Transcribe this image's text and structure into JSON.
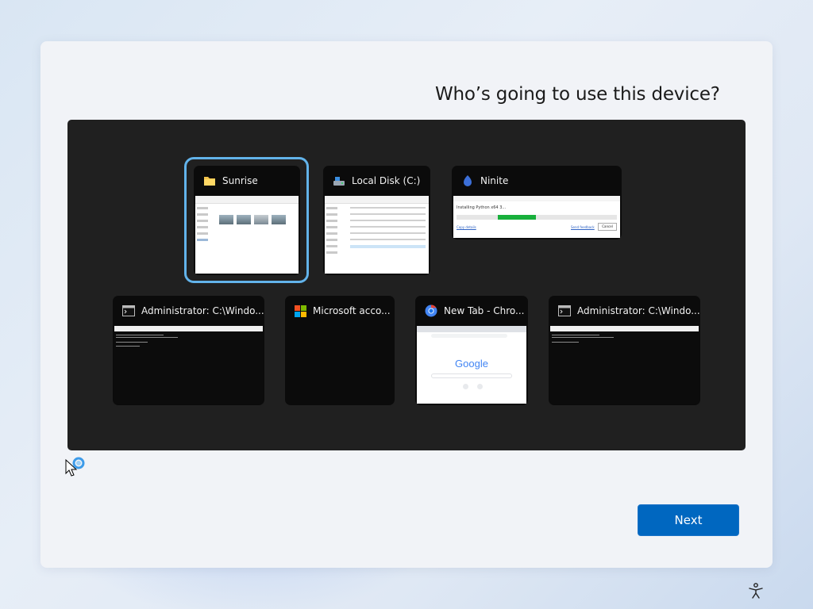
{
  "page": {
    "title": "Who’s going to use this device?"
  },
  "windows": [
    {
      "title": "Sunrise",
      "icon": "folder-icon"
    },
    {
      "title": "Local Disk (C:)",
      "icon": "drive-icon"
    },
    {
      "title": "Ninite",
      "icon": "ninite-icon"
    },
    {
      "title": "Administrator: C:\\Windo...",
      "icon": "console-icon"
    },
    {
      "title": "Microsoft acco...",
      "icon": "microsoft-logo-icon"
    },
    {
      "title": "New Tab - Chro...",
      "icon": "chrome-icon"
    },
    {
      "title": "Administrator: C:\\Windo...",
      "icon": "console-icon"
    }
  ],
  "ninite": {
    "status": "Installing Python x64 3...",
    "link1": "Copy details",
    "link2": "Send feedback",
    "cancel": "Cancel",
    "progress_percent": 24
  },
  "chrome": {
    "logo": "Google"
  },
  "buttons": {
    "next": "Next"
  },
  "colors": {
    "accent": "#0067c0",
    "selection": "#62b3ea",
    "switcher_bg": "#202020"
  }
}
